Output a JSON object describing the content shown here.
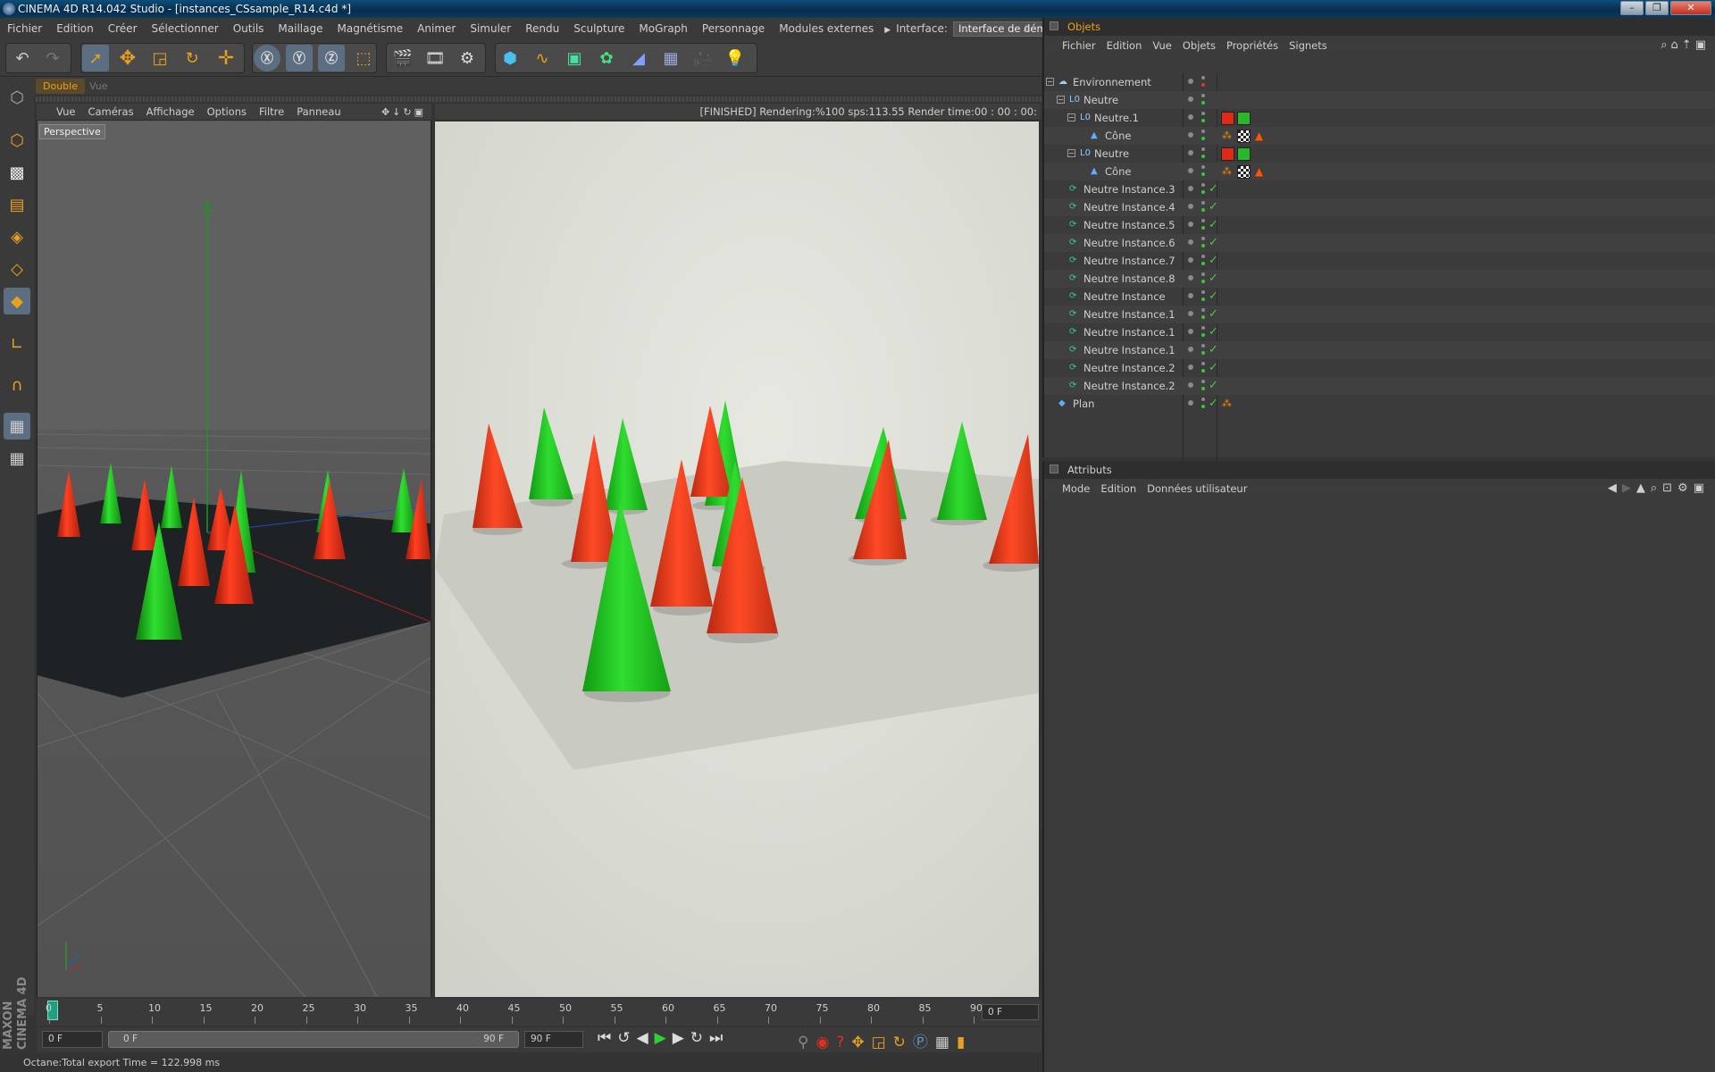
{
  "window": {
    "title": "CINEMA 4D R14.042 Studio - [instances_CSsample_R14.c4d *]",
    "controls": [
      "–",
      "❐",
      "✕"
    ]
  },
  "menubar": {
    "items": [
      "Fichier",
      "Edition",
      "Créer",
      "Sélectionner",
      "Outils",
      "Maillage",
      "Magnétisme",
      "Animer",
      "Simuler",
      "Rendu",
      "Sculpture",
      "MoGraph",
      "Personnage",
      "Modules externes"
    ],
    "interface_label": "Interface:",
    "interface_value": "Interface de démarrage (Utilisateur)"
  },
  "layout_tabs": [
    "Double",
    "Vue"
  ],
  "viewport_left": {
    "menu": [
      "Vue",
      "Caméras",
      "Affichage",
      "Options",
      "Filtre",
      "Panneau"
    ],
    "camera_label": "Perspective"
  },
  "viewport_right": {
    "status": "[FINISHED]  Rendering:%100 sps:113.55 Render time:00 : 00 : 00:"
  },
  "timeline": {
    "ticks": [
      "0",
      "5",
      "10",
      "15",
      "20",
      "25",
      "30",
      "35",
      "40",
      "45",
      "50",
      "55",
      "60",
      "65",
      "70",
      "75",
      "80",
      "85",
      "90"
    ],
    "current_frame": "0 F"
  },
  "playbar": {
    "start_field": "0 F",
    "range_start": "0 F",
    "range_end": "90 F",
    "end_field": "90 F"
  },
  "statusbar": {
    "text": "Octane:Total export Time = 122.998 ms"
  },
  "objects_panel": {
    "title": "Objets",
    "menu": [
      "Fichier",
      "Edition",
      "Vue",
      "Objets",
      "Propriétés",
      "Signets"
    ],
    "tree": [
      {
        "name": "Environnement",
        "icon": "environment-icon"
      },
      {
        "name": "Neutre",
        "icon": "null-icon"
      },
      {
        "name": "Neutre.1",
        "icon": "null-icon"
      },
      {
        "name": "Cône",
        "icon": "cone-icon"
      },
      {
        "name": "Neutre",
        "icon": "null-icon"
      },
      {
        "name": "Cône",
        "icon": "cone-icon"
      },
      {
        "name": "Neutre Instance.3",
        "icon": "instance-icon"
      },
      {
        "name": "Neutre Instance.4",
        "icon": "instance-icon"
      },
      {
        "name": "Neutre Instance.5",
        "icon": "instance-icon"
      },
      {
        "name": "Neutre Instance.6",
        "icon": "instance-icon"
      },
      {
        "name": "Neutre Instance.7",
        "icon": "instance-icon"
      },
      {
        "name": "Neutre Instance.8",
        "icon": "instance-icon"
      },
      {
        "name": "Neutre Instance",
        "icon": "instance-icon"
      },
      {
        "name": "Neutre Instance.1",
        "icon": "instance-icon"
      },
      {
        "name": "Neutre Instance.1",
        "icon": "instance-icon"
      },
      {
        "name": "Neutre Instance.1",
        "icon": "instance-icon"
      },
      {
        "name": "Neutre Instance.2",
        "icon": "instance-icon"
      },
      {
        "name": "Neutre Instance.2",
        "icon": "instance-icon"
      },
      {
        "name": "Plan",
        "icon": "plane-icon"
      }
    ]
  },
  "attributes_panel": {
    "title": "Attributs",
    "menu": [
      "Mode",
      "Edition",
      "Données utilisateur"
    ]
  },
  "colors": {
    "accent": "#e8a020",
    "selected_tool": "#5b6e82",
    "cone_red": "#e03818",
    "cone_green": "#22bb22"
  }
}
